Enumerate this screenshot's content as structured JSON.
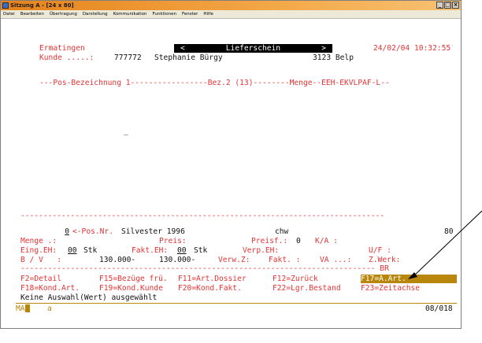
{
  "window": {
    "title": "Sitzung A - [24 x 80]",
    "buttons": [
      "_",
      "□",
      "×"
    ]
  },
  "menu": [
    "Datei",
    "Bearbeiten",
    "Übertragung",
    "Darstellung",
    "Kommunikation",
    "Funktionen",
    "Fenster",
    "Hilfe"
  ],
  "header": {
    "company": "Ermatingen",
    "nav_left": "<",
    "screen_title": "Lieferschein",
    "nav_right": ">",
    "datetime": "24/02/04 10:32:55",
    "kunde_label": "Kunde .....:",
    "kunde_nr": "777772",
    "kunde_name": "Stephanie Bürgy",
    "kunde_plz_ort": "3123 Belp"
  },
  "columns_header": "---Pos-Bezeichnung 1-----------------Bez.2 (13)--------Menge--EEH-EKVLPAF-L--",
  "cursor_char": "_",
  "detail": {
    "divider": "--------------------------------------------------------------------------------",
    "pos_nr_value": "0",
    "pos_nr_label": "<-Pos.Nr.",
    "article": "Silvester 1996",
    "user": "chw",
    "count": "80",
    "menge_label": "Menge .:",
    "preis_label": "Preis:",
    "preisf_label": "Preisf.:",
    "preisf_value": "0",
    "ka_label": "K/A :",
    "eing_label": "Eing.EH:",
    "eing_value": "00",
    "eing_unit": "Stk",
    "fakt_label": "Fakt.EH:",
    "fakt_value": "00",
    "fakt_unit": "Stk",
    "verp_label": "Verp.EH:",
    "uf_label": "U/F :",
    "bv_label": "B / V   :",
    "bv_value1": "130.000-",
    "bv_value2": "130.000-",
    "verwz_label": "Verw.Z:",
    "fakt2_label": "Fakt. :",
    "va_label": "VA ...:",
    "zwerk_label": "Z.Werk:",
    "divider2": "------------------------------------------------------------------------------ BR"
  },
  "fkeys": {
    "row1": [
      "F2=Detail",
      "F15=Bezüge frü.",
      "F11=Art.Dossier",
      "F12=Zurück",
      "F17=A.Art."
    ],
    "row2": [
      "F18=Kond.Art.",
      "F19=Kond.Kunde",
      "F20=Kond.Fakt.",
      "F22=Lgr.Bestand",
      "F23=Zeitachse"
    ]
  },
  "message": "Keine Auswahl(Wert) ausgewählt",
  "status": {
    "left": "MA",
    "mode": "a",
    "position": "08/018"
  },
  "colors": {
    "field_label": "#e23434",
    "field_value": "#1f3e9c",
    "status": "#b8860b",
    "highlight": "#b8860b"
  }
}
